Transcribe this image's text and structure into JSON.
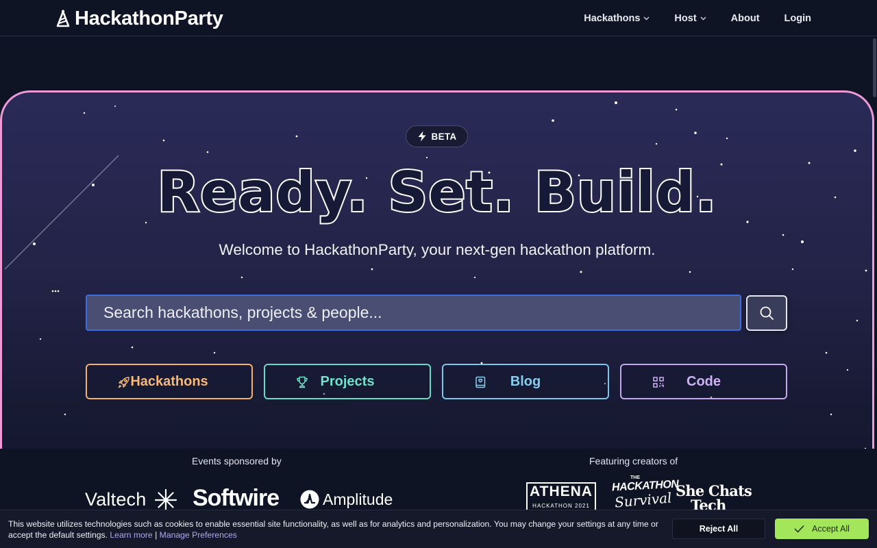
{
  "header": {
    "brand": "HackathonParty",
    "nav": [
      {
        "label": "Hackathons",
        "has_dropdown": true
      },
      {
        "label": "Host",
        "has_dropdown": true
      },
      {
        "label": "About",
        "has_dropdown": false
      },
      {
        "label": "Login",
        "has_dropdown": false
      }
    ]
  },
  "hero": {
    "badge": "BETA",
    "headline": "Ready. Set. Build.",
    "subheadline": "Welcome to HackathonParty, your next-gen hackathon platform.",
    "search": {
      "placeholder": "Search hackathons, projects & people..."
    },
    "categories": [
      {
        "label": "Hackathons",
        "icon": "rocket-icon",
        "color": "#f8b878"
      },
      {
        "label": "Projects",
        "icon": "trophy-icon",
        "color": "#6fe2cc"
      },
      {
        "label": "Blog",
        "icon": "book-icon",
        "color": "#86cdf0"
      },
      {
        "label": "Code",
        "icon": "qr-code-icon",
        "color": "#cfb2f6"
      }
    ],
    "border_color": "#ee9ad6"
  },
  "sponsors": {
    "heading": "Events sponsored by",
    "logos": [
      "Valtech",
      "Softwire",
      "Amplitude"
    ]
  },
  "creators": {
    "heading": "Featuring creators of",
    "logos": {
      "athena": {
        "name": "ATHENA",
        "sub": "HACKATHON 2021"
      },
      "survival": {
        "the": "THE",
        "line1": "HACKATHON",
        "line2": "Survival"
      },
      "shechats": {
        "line1": "She Chats",
        "line2": "Tech"
      }
    }
  },
  "cookie_banner": {
    "text": "This website utilizes technologies such as cookies to enable essential site functionality, as well as for analytics and personalization. You may change your settings at any time or accept the default settings.",
    "learn_more": "Learn more",
    "separator": "|",
    "manage": "Manage Preferences",
    "reject_label": "Reject All",
    "accept_label": "Accept All",
    "accept_color": "#a3e55b"
  }
}
